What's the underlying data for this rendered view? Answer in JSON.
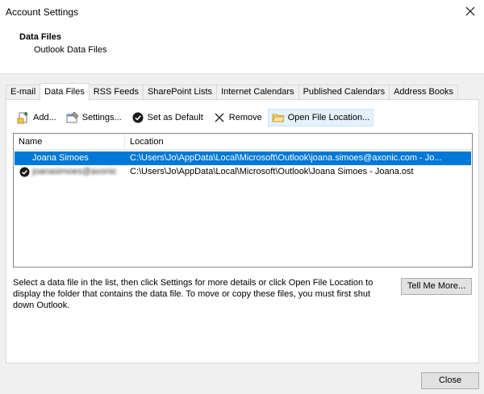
{
  "window": {
    "title": "Account Settings"
  },
  "header": {
    "title": "Data Files",
    "subtitle": "Outlook Data Files"
  },
  "tabs": [
    {
      "label": "E-mail"
    },
    {
      "label": "Data Files"
    },
    {
      "label": "RSS Feeds"
    },
    {
      "label": "SharePoint Lists"
    },
    {
      "label": "Internet Calendars"
    },
    {
      "label": "Published Calendars"
    },
    {
      "label": "Address Books"
    }
  ],
  "active_tab": "Data Files",
  "toolbar": {
    "add": "Add...",
    "settings": "Settings...",
    "set_default": "Set as Default",
    "remove": "Remove",
    "open_location": "Open File Location..."
  },
  "list": {
    "columns": {
      "name": "Name",
      "location": "Location"
    },
    "rows": [
      {
        "name": "Joana Simoes",
        "location": "C:\\Users\\Jo\\AppData\\Local\\Microsoft\\Outlook\\joana.simoes@axonic.com - Jo...",
        "selected": true,
        "is_default": false
      },
      {
        "name": "joanasimoes@axonic",
        "location": "C:\\Users\\Jo\\AppData\\Local\\Microsoft\\Outlook\\Joana Simoes - Joana.ost",
        "selected": false,
        "is_default": true
      }
    ]
  },
  "description": "Select a data file in the list, then click Settings for more details or click Open File Location to display the folder that contains the data file. To move or copy these files, you must first shut down Outlook.",
  "buttons": {
    "tell_me_more": "Tell Me More...",
    "close": "Close"
  },
  "colors": {
    "selection": "#0078d7",
    "hover": "#e5f1fb"
  }
}
